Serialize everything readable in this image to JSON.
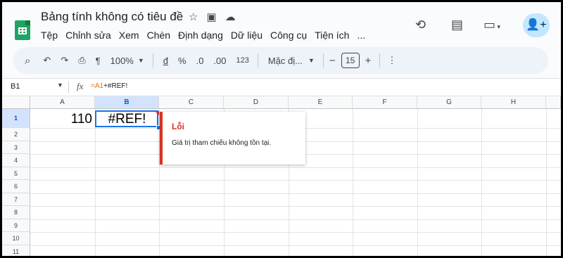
{
  "app": {
    "title": "Bảng tính không có tiêu đề",
    "menu": [
      "Tệp",
      "Chỉnh sửa",
      "Xem",
      "Chèn",
      "Định dạng",
      "Dữ liệu",
      "Công cụ",
      "Tiện ích",
      "..."
    ]
  },
  "toolbar": {
    "zoom": "100%",
    "currency": "đ",
    "percent": "%",
    "dec_decrease": ".0",
    "dec_increase": ".00",
    "number_format": "123",
    "font": "Mặc đị...",
    "font_size": "15",
    "minus": "−",
    "plus": "+"
  },
  "formula_bar": {
    "cell_ref": "B1",
    "fx": "fx",
    "formula_a1": "=A1",
    "formula_rest": "+#REF!"
  },
  "grid": {
    "columns": [
      "A",
      "B",
      "C",
      "D",
      "E",
      "F",
      "G",
      "H"
    ],
    "rows": [
      "1",
      "2",
      "3",
      "4",
      "5",
      "6",
      "7",
      "8",
      "9",
      "10",
      "11"
    ],
    "cells": {
      "A1": "110",
      "B1": "#REF!"
    }
  },
  "error_popup": {
    "title": "Lỗi",
    "message": "Giá trị tham chiếu không tồn tại."
  },
  "colors": {
    "accent": "#1a73e8",
    "error": "#d93025",
    "sheets_green": "#1fa463",
    "formula_ref": "#e37400"
  }
}
